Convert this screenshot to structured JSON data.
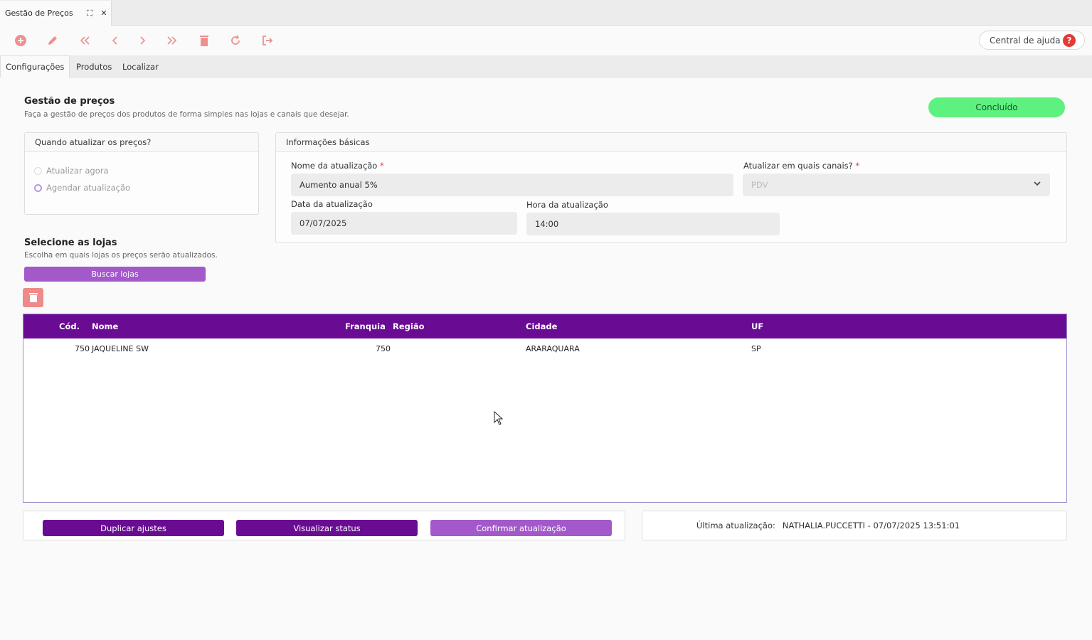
{
  "window": {
    "tab_title": "Gestão de Preços",
    "expand_icon": "⛶",
    "close_icon": "✕"
  },
  "toolbar": {
    "icons": [
      "add-icon",
      "edit-icon",
      "first-icon",
      "previous-icon",
      "next-icon",
      "last-icon",
      "delete-icon",
      "refresh-icon",
      "exit-icon"
    ],
    "help_label": "Central de ajuda"
  },
  "tabs": [
    "Configurações",
    "Produtos",
    "Localizar"
  ],
  "header": {
    "title": "Gestão de preços",
    "subtitle": "Faça a gestão de preços dos produtos de forma simples nas lojas e canais que desejar.",
    "status": "Concluído"
  },
  "when_panel": {
    "title": "Quando atualizar os preços?",
    "options": [
      "Atualizar agora",
      "Agendar atualização"
    ],
    "selected": "Agendar atualização"
  },
  "basic_info": {
    "title": "Informações básicas",
    "name_label": "Nome da atualização",
    "name_value": "Aumento anual 5%",
    "channels_label": "Atualizar em quais canais?",
    "channels_value": "PDV",
    "date_label": "Data da atualização",
    "date_value": "07/07/2025",
    "time_label": "Hora da atualização",
    "time_value": "14:00",
    "required_mark": "*"
  },
  "stores": {
    "title": "Selecione as lojas",
    "subtitle": "Escolha em quais lojas os preços serão atualizados.",
    "search_button": "Buscar lojas",
    "columns": [
      "Cód.",
      "Nome",
      "Franquia",
      "Região",
      "Cidade",
      "UF"
    ],
    "rows": [
      {
        "cod": "750",
        "nome": "JAQUELINE SW",
        "franquia": "750",
        "regiao": "",
        "cidade": "ARARAQUARA",
        "uf": "SP"
      }
    ]
  },
  "actions": {
    "duplicate": "Duplicar ajustes",
    "view_status": "Visualizar status",
    "confirm": "Confirmar atualização"
  },
  "last_update": {
    "label": "Última atualização:",
    "value": "NATHALIA.PUCCETTI - 07/07/2025 13:51:01"
  },
  "colors": {
    "purple": "#6a0b94",
    "light_purple": "#a359c9",
    "green": "#5df27f",
    "red_icon": "#ef8f8f"
  }
}
